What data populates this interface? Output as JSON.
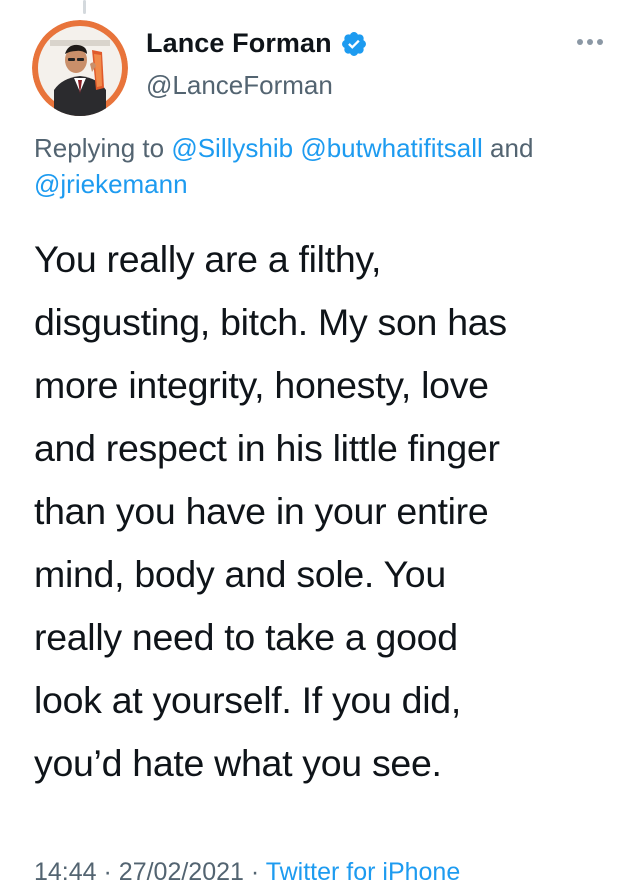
{
  "tweet": {
    "author_name": "Lance Forman",
    "handle": "@LanceForman",
    "reply_prefix": "Replying to",
    "mentions": [
      "@Sillyshib",
      "@butwhatifitsall",
      "@jriekemann"
    ],
    "mention_joiner": "and",
    "text": "You really are a filthy,\ndisgusting, bitch.  My son has\nmore integrity, honesty, love\nand respect in his little finger\nthan you have in your entire\nmind, body and sole.  You\nreally need to take a good\nlook at yourself. If you did,\nyou’d hate what you see.",
    "time": "14:44",
    "date": "27/02/2021",
    "separator": "·",
    "source": "Twitter for iPhone"
  },
  "icons": {
    "verified": "verified-badge-icon",
    "more": "more-options-icon"
  },
  "colors": {
    "link": "#1d9bf0",
    "secondary_text": "#536471",
    "primary_text": "#0f1419",
    "avatar_ring": "#e8743b"
  }
}
